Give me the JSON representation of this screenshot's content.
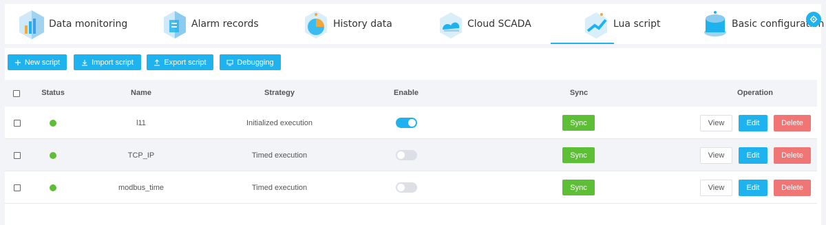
{
  "tabs": [
    {
      "label": "Data monitoring",
      "icon": "data-monitoring-icon"
    },
    {
      "label": "Alarm records",
      "icon": "alarm-records-icon"
    },
    {
      "label": "History data",
      "icon": "history-data-icon"
    },
    {
      "label": "Cloud SCADA",
      "icon": "cloud-scada-icon"
    },
    {
      "label": "Lua script",
      "icon": "lua-script-icon",
      "active": true
    },
    {
      "label": "Basic configuration",
      "icon": "basic-configuration-icon"
    }
  ],
  "toolbar": {
    "new_script": "New script",
    "import_script": "Import script",
    "export_script": "Export script",
    "debugging": "Debugging"
  },
  "table": {
    "headers": {
      "status": "Status",
      "name": "Name",
      "strategy": "Strategy",
      "enable": "Enable",
      "sync": "Sync",
      "operation": "Operation"
    },
    "rows": [
      {
        "name": "l11",
        "strategy": "Initialized execution",
        "enabled": true,
        "sync_label": "Sync",
        "view": "View",
        "edit": "Edit",
        "delete": "Delete"
      },
      {
        "name": "TCP_IP",
        "strategy": "Timed execution",
        "enabled": false,
        "sync_label": "Sync",
        "view": "View",
        "edit": "Edit",
        "delete": "Delete"
      },
      {
        "name": "modbus_time",
        "strategy": "Timed execution",
        "enabled": false,
        "sync_label": "Sync",
        "view": "View",
        "edit": "Edit",
        "delete": "Delete"
      }
    ]
  },
  "colors": {
    "accent": "#1eb3ee",
    "success": "#5dbf35",
    "danger": "#f07575",
    "header_bg": "#f2f4f8"
  }
}
